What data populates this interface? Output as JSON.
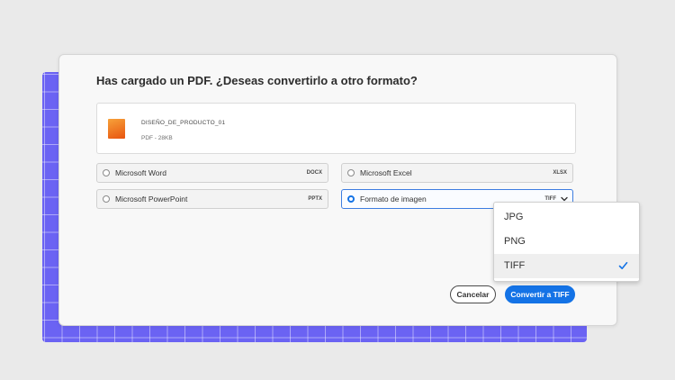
{
  "dialog": {
    "title": "Has cargado un PDF. ¿Deseas convertirlo a otro formato?",
    "file": {
      "name": "DISEÑO_DE_PRODUCTO_01",
      "meta": "PDF - 28KB"
    },
    "options": [
      {
        "label": "Microsoft Word",
        "ext": "DOCX",
        "selected": false
      },
      {
        "label": "Microsoft Excel",
        "ext": "XLSX",
        "selected": false
      },
      {
        "label": "Microsoft PowerPoint",
        "ext": "PPTX",
        "selected": false
      },
      {
        "label": "Formato de imagen",
        "ext": "TIFF",
        "selected": true
      }
    ],
    "cancel_label": "Cancelar",
    "convert_label": "Convertir a TIFF"
  },
  "dropdown": {
    "items": [
      {
        "label": "JPG",
        "selected": false
      },
      {
        "label": "PNG",
        "selected": false
      },
      {
        "label": "TIFF",
        "selected": true
      }
    ]
  },
  "colors": {
    "accent": "#1473e6",
    "grid_background": "#6b63f3",
    "file_icon": "#f28a24"
  },
  "icons": {
    "file": "pdf-file-icon",
    "chevron": "chevron-down-icon",
    "check": "checkmark-icon"
  }
}
